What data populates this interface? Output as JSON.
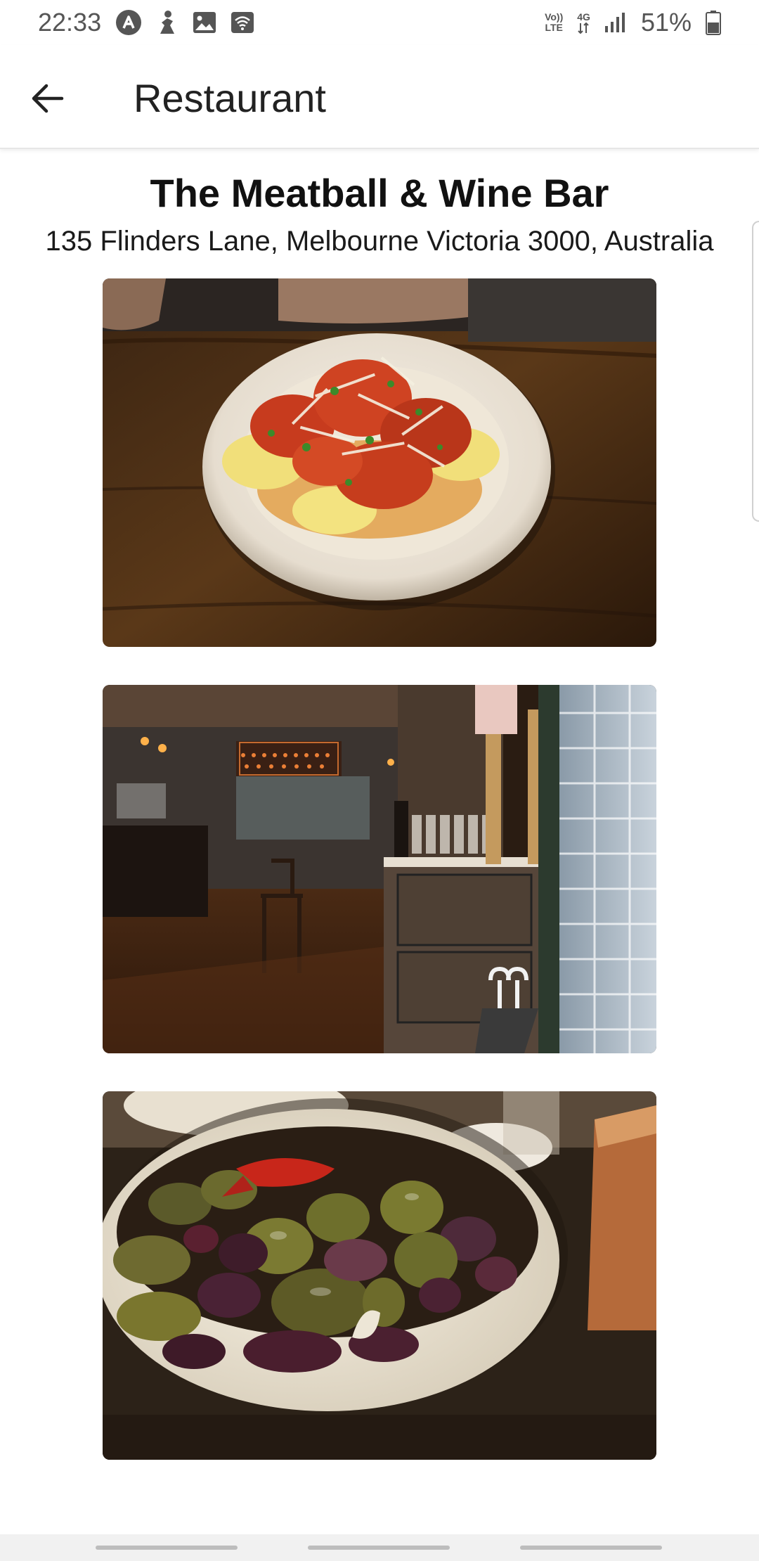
{
  "status_bar": {
    "time": "22:33",
    "network_volte": "Vo)\nLTE",
    "network_volte_top": "Vo))",
    "network_volte_bottom": "LTE",
    "network_type": "4G",
    "battery": "51%"
  },
  "app_bar": {
    "title": "Restaurant"
  },
  "restaurant": {
    "name": "The Meatball & Wine Bar",
    "address": "135 Flinders Lane, Melbourne Victoria 3000, Australia",
    "photos": [
      {
        "subject": "meatballs-with-tomato-sauce-and-mash"
      },
      {
        "subject": "restaurant-interior-meat-dept-sign"
      },
      {
        "subject": "bowl-of-olives"
      }
    ]
  },
  "colors": {
    "text_primary": "#111111",
    "status_gray": "#555555",
    "divider": "#e6e6e6",
    "nav_bar": "#f1f1f1"
  }
}
